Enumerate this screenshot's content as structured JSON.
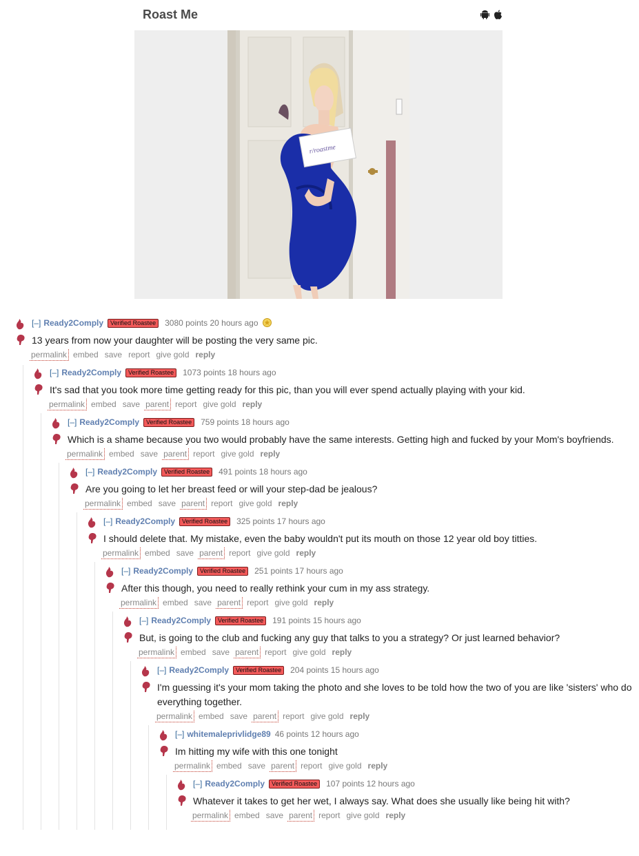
{
  "header": {
    "title": "Roast Me",
    "icons": [
      "android-icon",
      "apple-icon"
    ]
  },
  "photo": {
    "sign_text": "r/roastme"
  },
  "comments": [
    {
      "author": "Ready2Comply",
      "flair": "Verified Roastee",
      "score": "3080 points 20 hours ago",
      "gilded": true,
      "text": "13 years from now your daughter will be posting the very same pic."
    },
    {
      "author": "Ready2Comply",
      "flair": "Verified Roastee",
      "score": "1073 points 18 hours ago",
      "text": "It's sad that you took more time getting ready for this pic, than you will ever spend actually playing with your kid."
    },
    {
      "author": "Ready2Comply",
      "flair": "Verified Roastee",
      "score": "759 points 18 hours ago",
      "text": "Which is a shame because you two would probably have the same interests. Getting high and fucked by your Mom's boyfriends."
    },
    {
      "author": "Ready2Comply",
      "flair": "Verified Roastee",
      "score": "491 points 18 hours ago",
      "text": "Are you going to let her breast feed or will your step-dad be jealous?"
    },
    {
      "author": "Ready2Comply",
      "flair": "Verified Roastee",
      "score": "325 points 17 hours ago",
      "text": "I should delete that. My mistake, even the baby wouldn't put its mouth on those 12 year old boy titties."
    },
    {
      "author": "Ready2Comply",
      "flair": "Verified Roastee",
      "score": "251 points 17 hours ago",
      "text": "After this though, you need to really rethink your cum in my ass strategy."
    },
    {
      "author": "Ready2Comply",
      "flair": "Verified Roastee",
      "score": "191 points 15 hours ago",
      "text": "But, is going to the club and fucking any guy that talks to you a strategy? Or just learned behavior?"
    },
    {
      "author": "Ready2Comply",
      "flair": "Verified Roastee",
      "score": "204 points 15 hours ago",
      "text": "I'm guessing it's your mom taking the photo and she loves to be told how the two of you are like 'sisters' who do everything together."
    },
    {
      "author": "whitemaleprivlidge89",
      "flair": "",
      "score": "46 points 12 hours ago",
      "text": "Im hitting my wife with this one tonight"
    },
    {
      "author": "Ready2Comply",
      "flair": "Verified Roastee",
      "score": "107 points 12 hours ago",
      "text": "Whatever it takes to get her wet, I always say. What does she usually like being hit with?"
    }
  ],
  "labels": {
    "collapse": "[–]",
    "permalink": "permalink",
    "embed": "embed",
    "save": "save",
    "parent": "parent",
    "report": "report",
    "give_gold": "give gold",
    "reply": "reply"
  },
  "colors": {
    "author": "#5f7fb0",
    "flair_bg": "#f25a5a",
    "vote_arrow": "#b5364b"
  }
}
